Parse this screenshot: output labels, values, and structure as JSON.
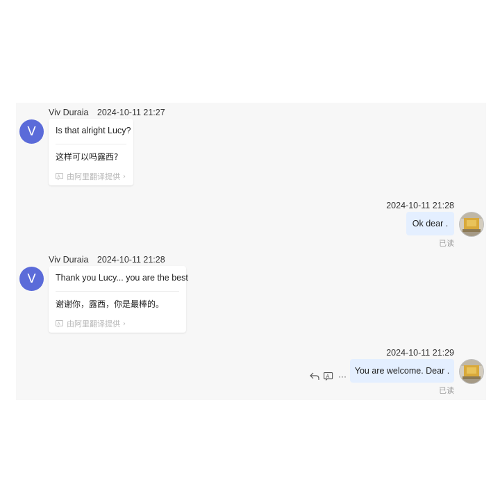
{
  "messages": [
    {
      "sender": "Viv Duraia",
      "avatar_letter": "V",
      "timestamp": "2024-10-11 21:27",
      "original": "Is that alright Lucy?",
      "translated": "这样可以吗露西?",
      "credit": "由阿里翻译提供",
      "credit_chevron": "›"
    },
    {
      "timestamp": "2024-10-11 21:28",
      "text": "Ok dear .",
      "status": "已读"
    },
    {
      "sender": "Viv Duraia",
      "avatar_letter": "V",
      "timestamp": "2024-10-11 21:28",
      "original": "Thank you Lucy... you are the best",
      "translated": "谢谢你，露西，你是最棒的。",
      "credit": "由阿里翻译提供",
      "credit_chevron": "›"
    },
    {
      "timestamp": "2024-10-11 21:29",
      "text": "You are welcome. Dear .",
      "status": "已读",
      "actions": [
        "reply-icon",
        "translate-icon",
        "more-icon"
      ],
      "more_glyph": "···"
    }
  ],
  "colors": {
    "panel_bg": "#f7f7f7",
    "avatar_bg": "#5b6bd9",
    "outgoing_bubble": "#e4efff",
    "read_status": "#9e9e9e"
  }
}
